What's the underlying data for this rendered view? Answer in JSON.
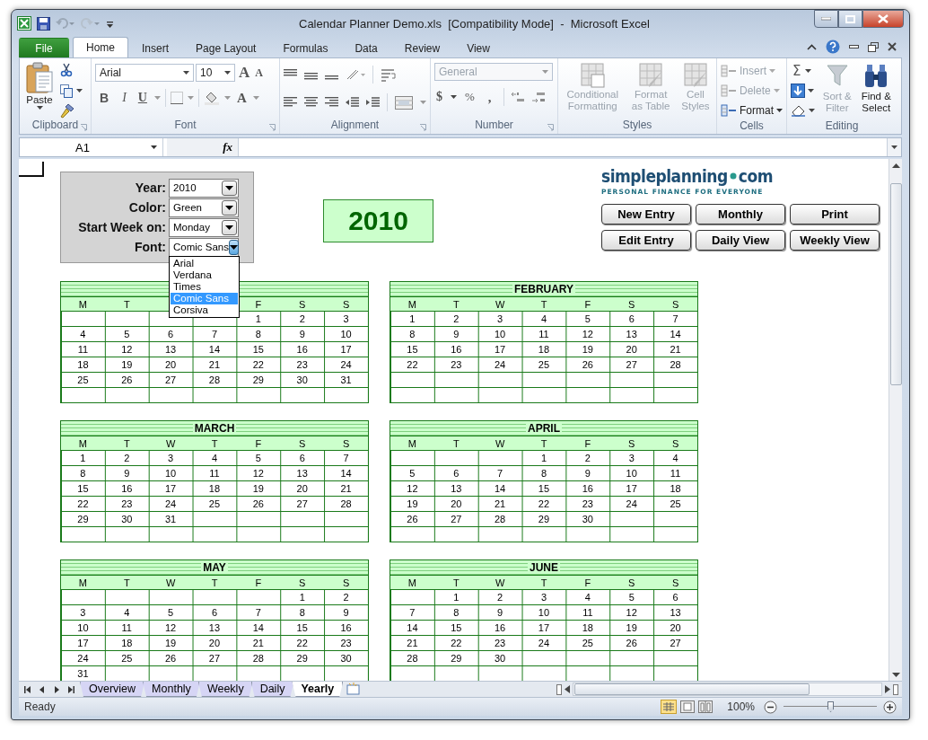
{
  "window": {
    "title": "Calendar Planner Demo.xls  [Compatibility Mode]  -  Microsoft Excel"
  },
  "ribbon_tabs": [
    {
      "label": "File",
      "kind": "file",
      "selected": false
    },
    {
      "label": "Home",
      "kind": "tab",
      "selected": true
    },
    {
      "label": "Insert",
      "kind": "tab",
      "selected": false
    },
    {
      "label": "Page Layout",
      "kind": "tab",
      "selected": false
    },
    {
      "label": "Formulas",
      "kind": "tab",
      "selected": false
    },
    {
      "label": "Data",
      "kind": "tab",
      "selected": false
    },
    {
      "label": "Review",
      "kind": "tab",
      "selected": false
    },
    {
      "label": "View",
      "kind": "tab",
      "selected": false
    }
  ],
  "ribbon": {
    "clipboard": {
      "label": "Clipboard",
      "paste": "Paste"
    },
    "font": {
      "label": "Font",
      "font_name": "Arial",
      "font_size": "10",
      "grow": "A",
      "shrink": "A",
      "bold": "B",
      "italic": "I",
      "underline": "U",
      "font_color": "A"
    },
    "alignment": {
      "label": "Alignment"
    },
    "number": {
      "label": "Number",
      "format": "General",
      "currency": "$",
      "percent": "%",
      "comma": ","
    },
    "styles": {
      "label": "Styles",
      "items": [
        {
          "label": "Conditional Formatting",
          "disabled": true
        },
        {
          "label": "Format as Table",
          "disabled": true
        },
        {
          "label": "Cell Styles",
          "disabled": true
        }
      ]
    },
    "cells": {
      "label": "Cells",
      "items": [
        {
          "label": "Insert",
          "disabled": true
        },
        {
          "label": "Delete",
          "disabled": true
        },
        {
          "label": "Format",
          "disabled": false
        }
      ]
    },
    "editing": {
      "label": "Editing",
      "sum": "Σ",
      "items": [
        {
          "label": "Sort & Filter",
          "disabled": true
        },
        {
          "label": "Find & Select",
          "disabled": false
        }
      ]
    }
  },
  "formula_bar": {
    "name_box": "A1",
    "fx": "fx"
  },
  "controls": [
    {
      "label": "Year:",
      "value": "2010",
      "expanded": false
    },
    {
      "label": "Color:",
      "value": "Green",
      "expanded": false
    },
    {
      "label": "Start Week on:",
      "value": "Monday",
      "expanded": false
    },
    {
      "label": "Font:",
      "value": "Comic Sans",
      "expanded": true
    }
  ],
  "font_options": [
    {
      "label": "Arial",
      "selected": false
    },
    {
      "label": "Verdana",
      "selected": false
    },
    {
      "label": "Times",
      "selected": false
    },
    {
      "label": "Comic Sans",
      "selected": true
    },
    {
      "label": "Corsiva",
      "selected": false
    }
  ],
  "year_banner": "2010",
  "logo": {
    "name": "simpleplanning",
    "domain": "com",
    "tagline": "PERSONAL FINANCE FOR EVERYONE"
  },
  "action_buttons": [
    "New Entry",
    "Monthly",
    "Print",
    "Edit Entry",
    "Daily View",
    "Weekly View"
  ],
  "calendar_rows": [
    {
      "months": [
        {
          "weekdays": [
            {
              "labels": [
                "M",
                "T"
              ],
              "kind": "start"
            },
            {
              "labels": [
                "F",
                "S",
                "S"
              ],
              "kind": "end"
            }
          ],
          "weeks": [
            {
              "days": [
                "1",
                "2",
                "3"
              ],
              "kind": "end"
            },
            {
              "days": [
                "4",
                "5",
                "6",
                "7",
                "8",
                "9",
                "10"
              ],
              "kind": "start"
            },
            {
              "days": [
                "11",
                "12",
                "13",
                "14",
                "15",
                "16",
                "17"
              ],
              "kind": "start"
            },
            {
              "days": [
                "18",
                "19",
                "20",
                "21",
                "22",
                "23",
                "24"
              ],
              "kind": "start"
            },
            {
              "days": [
                "25",
                "26",
                "27",
                "28",
                "29",
                "30",
                "31"
              ],
              "kind": "start"
            }
          ]
        },
        {
          "title": "FEBRUARY",
          "weekdays": [
            {
              "labels": [
                "M",
                "T",
                "W",
                "T",
                "F",
                "S",
                "S"
              ],
              "kind": "start"
            }
          ],
          "weeks": [
            {
              "days": [
                "1",
                "2",
                "3",
                "4",
                "5",
                "6",
                "7"
              ],
              "kind": "start"
            },
            {
              "days": [
                "8",
                "9",
                "10",
                "11",
                "12",
                "13",
                "14"
              ],
              "kind": "start"
            },
            {
              "days": [
                "15",
                "16",
                "17",
                "18",
                "19",
                "20",
                "21"
              ],
              "kind": "start"
            },
            {
              "days": [
                "22",
                "23",
                "24",
                "25",
                "26",
                "27",
                "28"
              ],
              "kind": "start"
            }
          ]
        }
      ]
    },
    {
      "months": [
        {
          "title": "MARCH",
          "weekdays": [
            {
              "labels": [
                "M",
                "T",
                "W",
                "T",
                "F",
                "S",
                "S"
              ],
              "kind": "start"
            }
          ],
          "weeks": [
            {
              "days": [
                "1",
                "2",
                "3",
                "4",
                "5",
                "6",
                "7"
              ],
              "kind": "start"
            },
            {
              "days": [
                "8",
                "9",
                "10",
                "11",
                "12",
                "13",
                "14"
              ],
              "kind": "start"
            },
            {
              "days": [
                "15",
                "16",
                "17",
                "18",
                "19",
                "20",
                "21"
              ],
              "kind": "start"
            },
            {
              "days": [
                "22",
                "23",
                "24",
                "25",
                "26",
                "27",
                "28"
              ],
              "kind": "start"
            },
            {
              "days": [
                "29",
                "30",
                "31"
              ],
              "kind": "start"
            }
          ]
        },
        {
          "title": "APRIL",
          "weekdays": [
            {
              "labels": [
                "M",
                "T",
                "W",
                "T",
                "F",
                "S",
                "S"
              ],
              "kind": "start"
            }
          ],
          "weeks": [
            {
              "days": [
                "1",
                "2",
                "3",
                "4"
              ],
              "kind": "end"
            },
            {
              "days": [
                "5",
                "6",
                "7",
                "8",
                "9",
                "10",
                "11"
              ],
              "kind": "start"
            },
            {
              "days": [
                "12",
                "13",
                "14",
                "15",
                "16",
                "17",
                "18"
              ],
              "kind": "start"
            },
            {
              "days": [
                "19",
                "20",
                "21",
                "22",
                "23",
                "24",
                "25"
              ],
              "kind": "start"
            },
            {
              "days": [
                "26",
                "27",
                "28",
                "29",
                "30"
              ],
              "kind": "start"
            }
          ]
        }
      ]
    },
    {
      "months": [
        {
          "title": "MAY",
          "weekdays": [
            {
              "labels": [
                "M",
                "T",
                "W",
                "T",
                "F",
                "S",
                "S"
              ],
              "kind": "start"
            }
          ],
          "weeks": [
            {
              "days": [
                "1",
                "2"
              ],
              "kind": "end"
            },
            {
              "days": [
                "3",
                "4",
                "5",
                "6",
                "7",
                "8",
                "9"
              ],
              "kind": "start"
            },
            {
              "days": [
                "10",
                "11",
                "12",
                "13",
                "14",
                "15",
                "16"
              ],
              "kind": "start"
            },
            {
              "days": [
                "17",
                "18",
                "19",
                "20",
                "21",
                "22",
                "23"
              ],
              "kind": "start"
            },
            {
              "days": [
                "24",
                "25",
                "26",
                "27",
                "28",
                "29",
                "30"
              ],
              "kind": "start"
            },
            {
              "days": [
                "31"
              ],
              "kind": "start"
            }
          ]
        },
        {
          "title": "JUNE",
          "weekdays": [
            {
              "labels": [
                "M",
                "T",
                "W",
                "T",
                "F",
                "S",
                "S"
              ],
              "kind": "start"
            }
          ],
          "weeks": [
            {
              "days": [
                "1",
                "2",
                "3",
                "4",
                "5",
                "6"
              ],
              "kind": "end"
            },
            {
              "days": [
                "7",
                "8",
                "9",
                "10",
                "11",
                "12",
                "13"
              ],
              "kind": "start"
            },
            {
              "days": [
                "14",
                "15",
                "16",
                "17",
                "18",
                "19",
                "20"
              ],
              "kind": "start"
            },
            {
              "days": [
                "21",
                "22",
                "23",
                "24",
                "25",
                "26",
                "27"
              ],
              "kind": "start"
            },
            {
              "days": [
                "28",
                "29",
                "30"
              ],
              "kind": "start"
            }
          ]
        }
      ]
    }
  ],
  "sheet_tabs": [
    {
      "label": "Overview",
      "selected": false
    },
    {
      "label": "Monthly",
      "selected": false
    },
    {
      "label": "Weekly",
      "selected": false
    },
    {
      "label": "Daily",
      "selected": false
    },
    {
      "label": "Yearly",
      "selected": true
    }
  ],
  "status_bar": {
    "status": "Ready",
    "zoom": "100%",
    "zoom_slider": {
      "level": 0.5
    }
  }
}
